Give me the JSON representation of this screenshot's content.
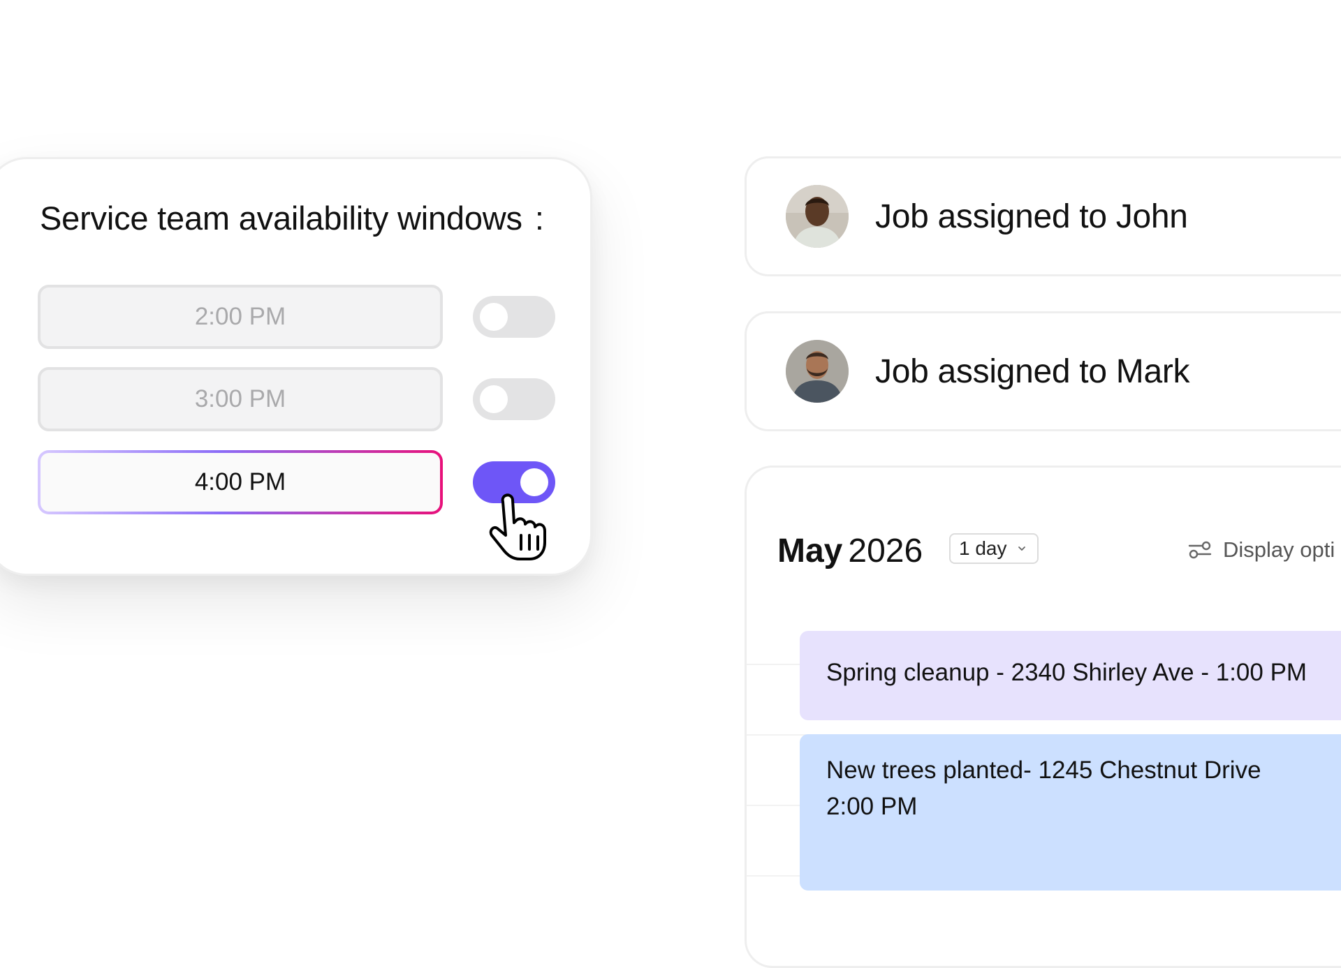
{
  "availability": {
    "title": "Service team availability windows",
    "colon": ":",
    "slots": [
      {
        "time": "2:00 PM",
        "enabled": false
      },
      {
        "time": "3:00 PM",
        "enabled": false
      },
      {
        "time": "4:00 PM",
        "enabled": true
      }
    ]
  },
  "assignments": [
    {
      "text": "Job assigned to John"
    },
    {
      "text": "Job assigned to Mark"
    }
  ],
  "calendar": {
    "month": "May",
    "year": "2026",
    "range": "1 day",
    "display_options": "Display opti",
    "events": [
      {
        "line1": "Spring cleanup - 2340 Shirley Ave - 1:00 PM",
        "color": "#e7e2fd"
      },
      {
        "line1": "New trees planted- 1245 Chestnut Drive",
        "line2": "2:00 PM",
        "color": "#cce0ff"
      }
    ]
  },
  "colors": {
    "toggle_on": "#6e56f7",
    "toggle_off": "#e3e3e4",
    "active_border_gradient": [
      "#d6c8ff",
      "#8b6cf7",
      "#e8107a"
    ]
  }
}
